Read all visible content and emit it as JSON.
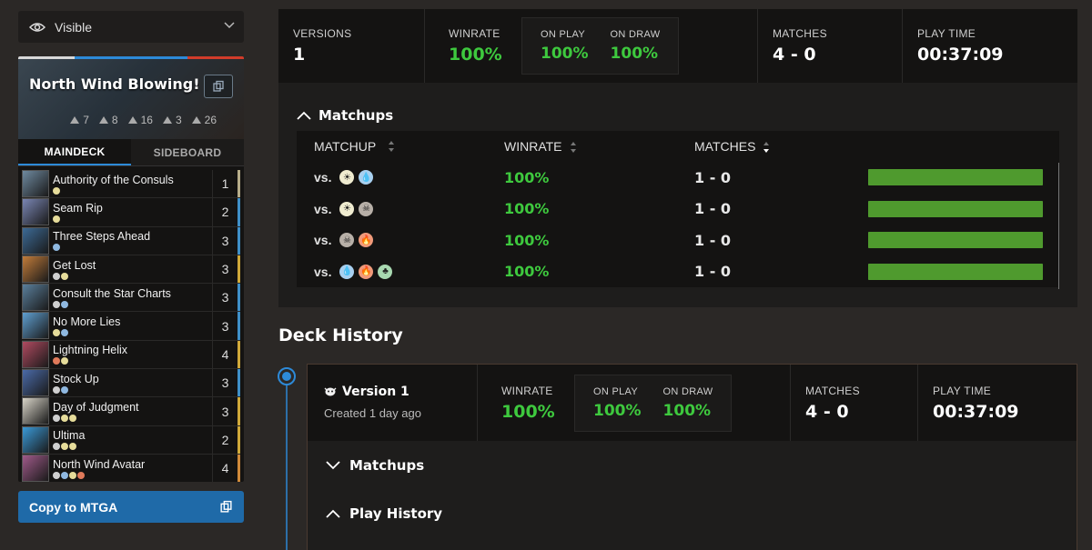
{
  "filter": {
    "value": "Visible"
  },
  "deck": {
    "title": "North Wind Blowing!",
    "strip_colors": [
      "#d8d8d8",
      "#2d8ad8",
      "#2d8ad8",
      "#d23c2a"
    ],
    "type_counts": [
      {
        "icon": "creature-icon",
        "count": "7"
      },
      {
        "icon": "artifact-icon",
        "count": "8"
      },
      {
        "icon": "instant-icon",
        "count": "16"
      },
      {
        "icon": "sorcery-icon",
        "count": "3"
      },
      {
        "icon": "land-icon",
        "count": "26"
      }
    ],
    "tabs": [
      "MAINDECK",
      "SIDEBOARD"
    ],
    "cards": [
      {
        "name": "Authority of the Consuls",
        "qty": "1",
        "art": "#6f8aa0",
        "edge": "#b7ad8a",
        "pips": [
          "#e6dc9a"
        ]
      },
      {
        "name": "Seam Rip",
        "qty": "2",
        "art": "#7a86b4",
        "edge": "#3f8fc8",
        "pips": [
          "#e6dc9a"
        ]
      },
      {
        "name": "Three Steps Ahead",
        "qty": "3",
        "art": "#3c6a96",
        "edge": "#3f8fc8",
        "pips": [
          "#8fb8e0"
        ]
      },
      {
        "name": "Get Lost",
        "qty": "3",
        "art": "#c27c3a",
        "edge": "#d0a93a",
        "pips": [
          "#cfcfcf",
          "#e6dc9a"
        ]
      },
      {
        "name": "Consult the Star Charts",
        "qty": "3",
        "art": "#5a7f9c",
        "edge": "#3f8fc8",
        "pips": [
          "#cfcfcf",
          "#8fb8e0"
        ]
      },
      {
        "name": "No More Lies",
        "qty": "3",
        "art": "#5f9fd0",
        "edge": "#3f8fc8",
        "pips": [
          "#e6dc9a",
          "#8fb8e0"
        ]
      },
      {
        "name": "Lightning Helix",
        "qty": "4",
        "art": "#b04a60",
        "edge": "#d0a93a",
        "pips": [
          "#e07a5a",
          "#e6dc9a"
        ]
      },
      {
        "name": "Stock Up",
        "qty": "3",
        "art": "#4a6aa8",
        "edge": "#3f8fc8",
        "pips": [
          "#cfcfcf",
          "#8fb8e0"
        ]
      },
      {
        "name": "Day of Judgment",
        "qty": "3",
        "art": "#d8d4c8",
        "edge": "#d0a93a",
        "pips": [
          "#cfcfcf",
          "#e6dc9a",
          "#e6dc9a"
        ]
      },
      {
        "name": "Ultima",
        "qty": "2",
        "art": "#3a9ad8",
        "edge": "#d0a93a",
        "pips": [
          "#cfcfcf",
          "#e6dc9a",
          "#e6dc9a"
        ]
      },
      {
        "name": "North Wind Avatar",
        "qty": "4",
        "art": "#a05a8a",
        "edge": "#d08a3a",
        "pips": [
          "#cfcfcf",
          "#8fb8e0",
          "#e6dc9a",
          "#e07a5a"
        ]
      }
    ]
  },
  "copy_button": {
    "label": "Copy to MTGA"
  },
  "stats": {
    "versions_label": "VERSIONS",
    "versions": "1",
    "winrate_label": "WINRATE",
    "winrate": "100%",
    "on_play_label": "ON PLAY",
    "on_play": "100%",
    "on_draw_label": "ON DRAW",
    "on_draw": "100%",
    "matches_label": "MATCHES",
    "matches": "4 - 0",
    "playtime_label": "PLAY TIME",
    "playtime": "00:37:09"
  },
  "matchups": {
    "title": "Matchups",
    "headers": [
      "MATCHUP",
      "WINRATE",
      "MATCHES"
    ],
    "vs_label": "vs.",
    "rows": [
      {
        "colors": [
          [
            "#f0ecd0",
            "☀"
          ],
          [
            "#a8d0f0",
            "💧"
          ]
        ],
        "winrate": "100%",
        "record": "1 - 0",
        "fill": 1.0
      },
      {
        "colors": [
          [
            "#f0ecd0",
            "☀"
          ],
          [
            "#b8b0a8",
            "☠"
          ]
        ],
        "winrate": "100%",
        "record": "1 - 0",
        "fill": 1.0
      },
      {
        "colors": [
          [
            "#b8b0a8",
            "☠"
          ],
          [
            "#f09a7a",
            "🔥"
          ]
        ],
        "winrate": "100%",
        "record": "1 - 0",
        "fill": 1.0
      },
      {
        "colors": [
          [
            "#a8d0f0",
            "💧"
          ],
          [
            "#f09a7a",
            "🔥"
          ],
          [
            "#a8d8b0",
            "♣"
          ]
        ],
        "winrate": "100%",
        "record": "1 - 0",
        "fill": 1.0
      }
    ]
  },
  "history": {
    "title": "Deck History",
    "version": {
      "name": "Version 1",
      "created": "Created 1 day ago",
      "winrate_label": "WINRATE",
      "winrate": "100%",
      "on_play_label": "ON PLAY",
      "on_play": "100%",
      "on_draw_label": "ON DRAW",
      "on_draw": "100%",
      "matches_label": "MATCHES",
      "matches": "4 - 0",
      "playtime_label": "PLAY TIME",
      "playtime": "00:37:09",
      "matchups_label": "Matchups",
      "play_history_label": "Play History"
    }
  }
}
